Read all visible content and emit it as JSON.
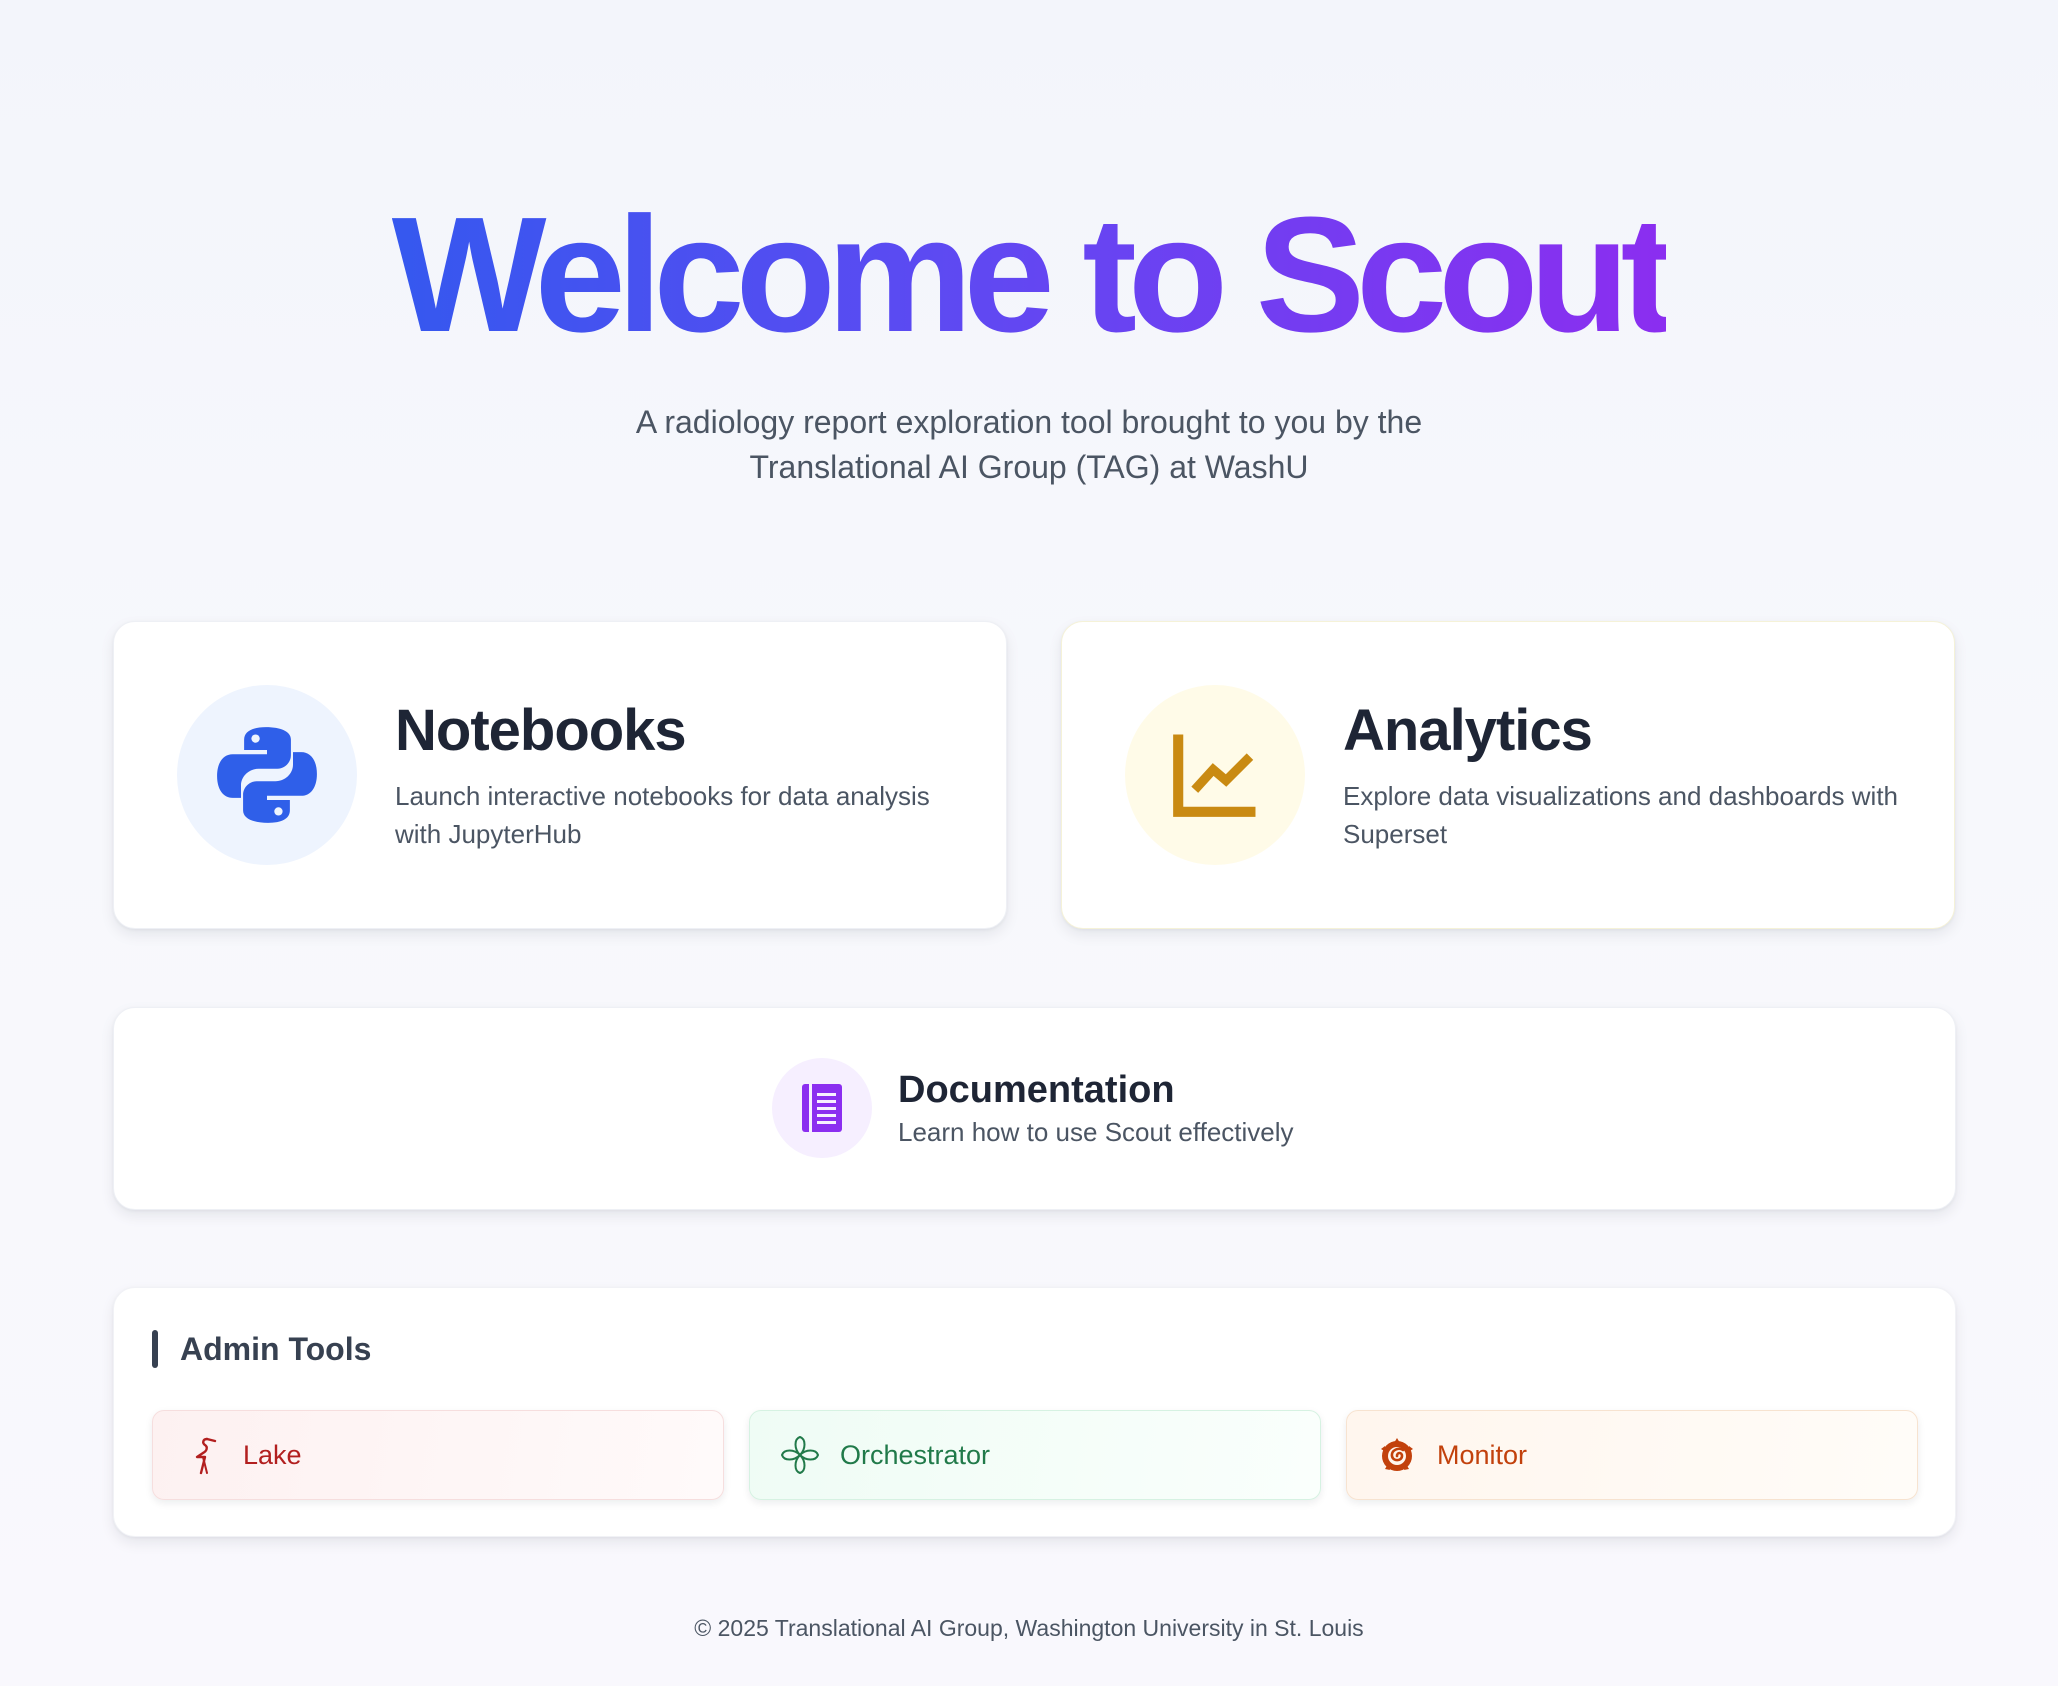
{
  "hero": {
    "title": "Welcome to Scout",
    "subtitle_line1": "A radiology report exploration tool brought to you by the",
    "subtitle_line2": "Translational AI Group (TAG) at WashU"
  },
  "cards": {
    "notebooks": {
      "title": "Notebooks",
      "description": "Launch interactive notebooks for data analysis with JupyterHub",
      "icon": "python-icon",
      "icon_color": "#2f5fe9",
      "icon_bg": "#eef4fe"
    },
    "analytics": {
      "title": "Analytics",
      "description": "Explore data visualizations and dashboards with Superset",
      "icon": "line-chart-icon",
      "icon_color": "#c98a12",
      "icon_bg": "#fffbe8"
    },
    "documentation": {
      "title": "Documentation",
      "description": "Learn how to use Scout effectively",
      "icon": "book-icon",
      "icon_color": "#8b2ef0",
      "icon_bg": "#f6efff"
    }
  },
  "admin": {
    "title": "Admin Tools",
    "tools": [
      {
        "label": "Lake",
        "icon": "heron-icon",
        "color": "#b21f1f"
      },
      {
        "label": "Orchestrator",
        "icon": "pinwheel-icon",
        "color": "#217a4a"
      },
      {
        "label": "Monitor",
        "icon": "grafana-icon",
        "color": "#c2410c"
      }
    ]
  },
  "footer": {
    "text": "© 2025 Translational AI Group, Washington University in St. Louis"
  }
}
